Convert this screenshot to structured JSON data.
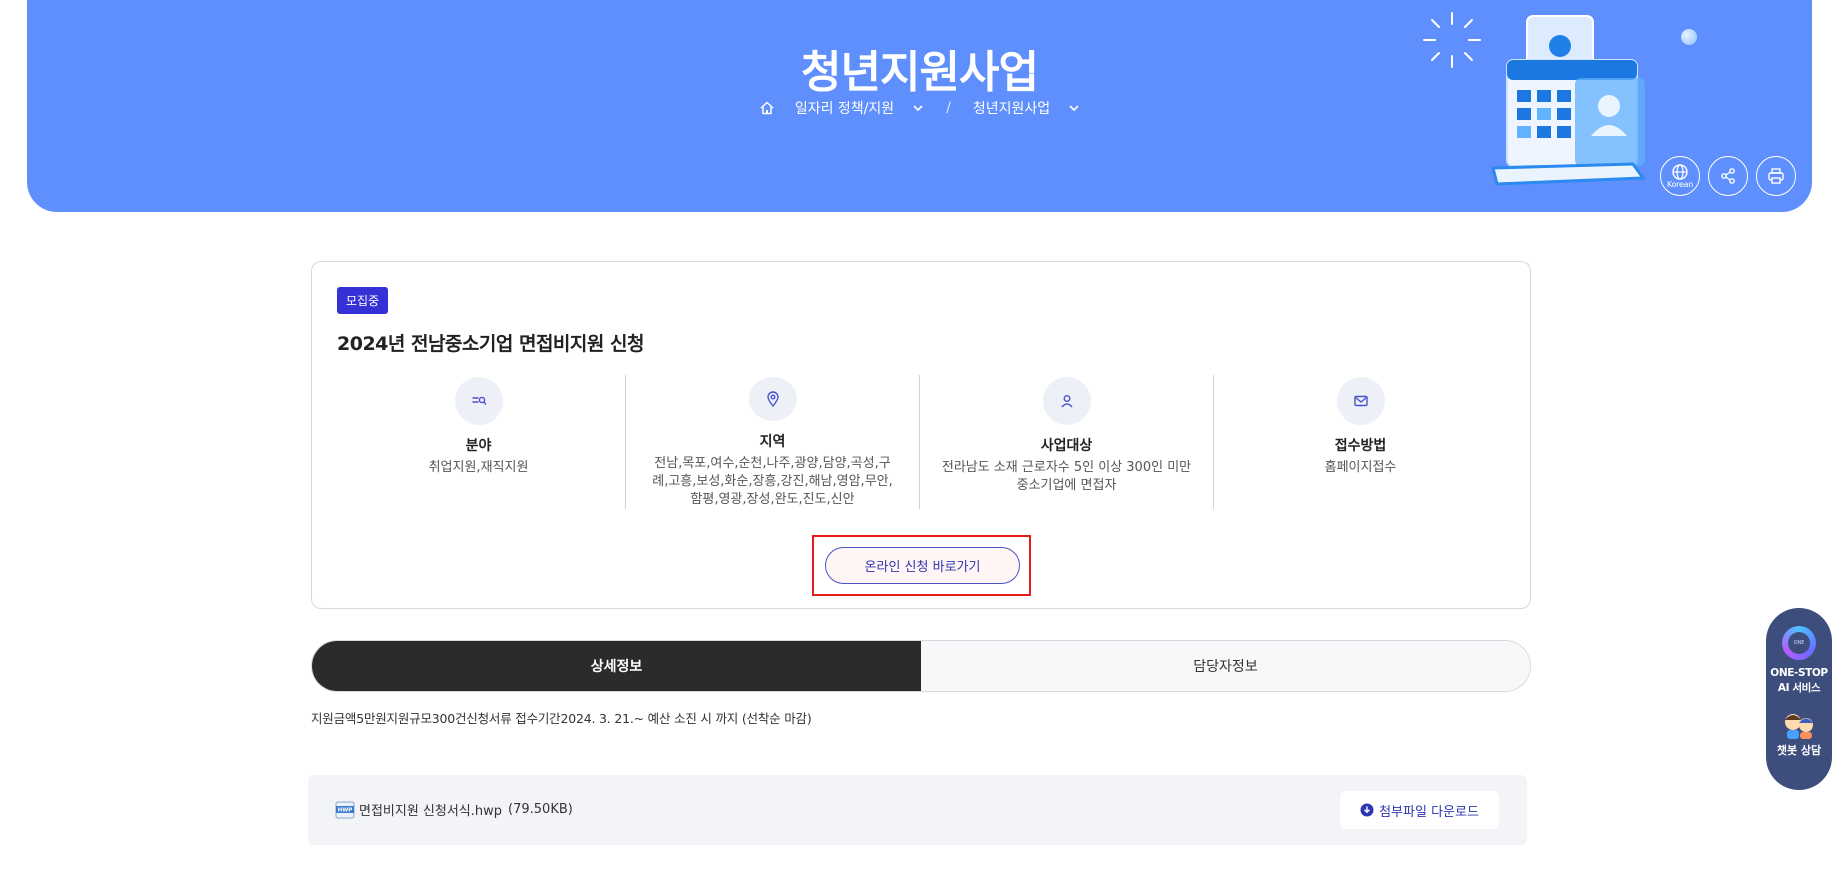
{
  "hero": {
    "title": "청년지원사업",
    "breadcrumb": {
      "level1": "일자리 정책/지원",
      "separator": "/",
      "level2": "청년지원사업"
    },
    "tools": {
      "language_label": "Korean"
    },
    "background_color": "#5e8ffc"
  },
  "card": {
    "badge": "모집중",
    "title": "2024년 전남중소기업 면접비지원 신청",
    "info": [
      {
        "label": "분야",
        "value": "취업지원,재직지원",
        "icon": "category-icon"
      },
      {
        "label": "지역",
        "value": "전남,목포,여수,순천,나주,광양,담양,곡성,구례,고흥,보성,화순,장흥,강진,해남,영암,무안,함평,영광,장성,완도,진도,신안",
        "icon": "location-pin-icon"
      },
      {
        "label": "사업대상",
        "value": "전라남도 소재 근로자수 5인 이상 300인 미만 중소기업에 면접자",
        "icon": "person-icon"
      },
      {
        "label": "접수방법",
        "value": "홈페이지접수",
        "icon": "mail-icon"
      }
    ],
    "apply_button": "온라인 신청 바로가기"
  },
  "tabs": [
    {
      "label": "상세정보",
      "active": true
    },
    {
      "label": "담당자정보",
      "active": false
    }
  ],
  "detail_text": "지원금액5만원지원규모300건신청서류 접수기간2024. 3. 21.~ 예산 소진 시 까지 (선착순 마감)",
  "attachment": {
    "file_icon_text": "HWP",
    "file_name": "면접비지원 신청서식.hwp",
    "file_size": "(79.50KB)",
    "download_label": "첨부파일 다운로드"
  },
  "floating": {
    "logo_text": "ONE",
    "label_line1": "ONE-STOP",
    "label_line2": "AI 서비스",
    "chatbot_label": "챗봇 상담"
  },
  "colors": {
    "badge": "#3531d6",
    "accent": "#2e35b0",
    "highlight": "#e41c1c",
    "active_tab": "#2b2b2b"
  }
}
